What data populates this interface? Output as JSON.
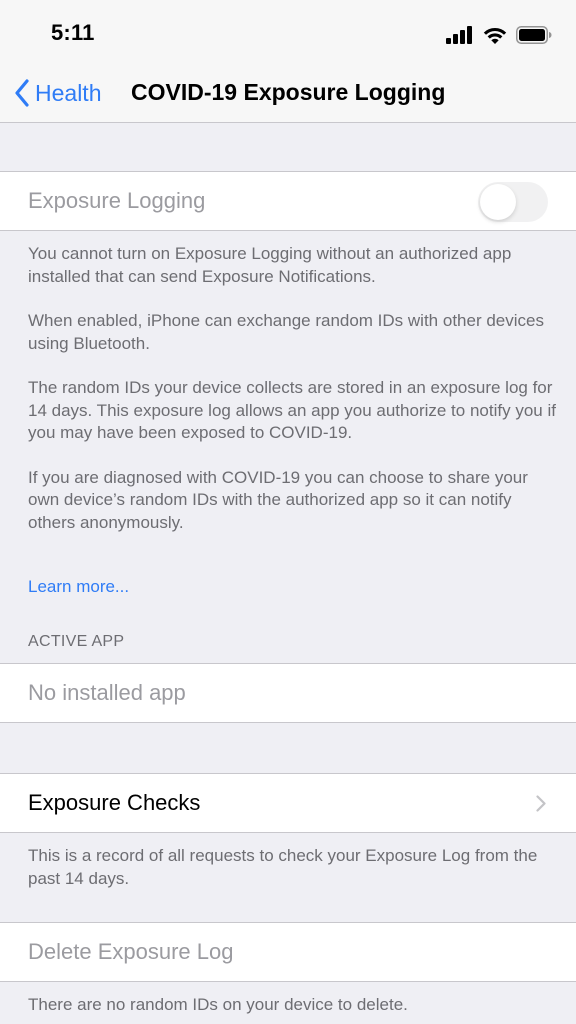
{
  "status_bar": {
    "time": "5:11",
    "signal_icon": "cellular-signal-icon",
    "wifi_icon": "wifi-icon",
    "battery_icon": "battery-icon"
  },
  "nav": {
    "back_label": "Health",
    "title": "COVID-19 Exposure Logging"
  },
  "exposure_logging": {
    "label": "Exposure Logging",
    "toggle_on": false,
    "toggle_enabled": false,
    "footer": [
      "You cannot turn on Exposure Logging without an authorized app installed that can send Exposure Notifications.",
      "When enabled, iPhone can exchange random IDs with other devices using Bluetooth.",
      "The random IDs your device collects are stored in an exposure log for 14 days. This exposure log allows an app you authorize to notify you if you may have been exposed to COVID-19.",
      "If you are diagnosed with COVID-19 you can choose to share your own device’s random IDs with the authorized app so it can notify others anonymously."
    ],
    "learn_more": "Learn more..."
  },
  "active_app": {
    "header": "ACTIVE APP",
    "value": "No installed app"
  },
  "exposure_checks": {
    "label": "Exposure Checks",
    "footer": "This is a record of all requests to check your Exposure Log from the past 14 days."
  },
  "delete_log": {
    "label": "Delete Exposure Log",
    "footer": "There are no random IDs on your device to delete."
  },
  "colors": {
    "accent": "#2f7cf6",
    "background": "#efeff4",
    "secondary_text": "#6d6d72",
    "disabled_text": "#9b9ba0"
  }
}
